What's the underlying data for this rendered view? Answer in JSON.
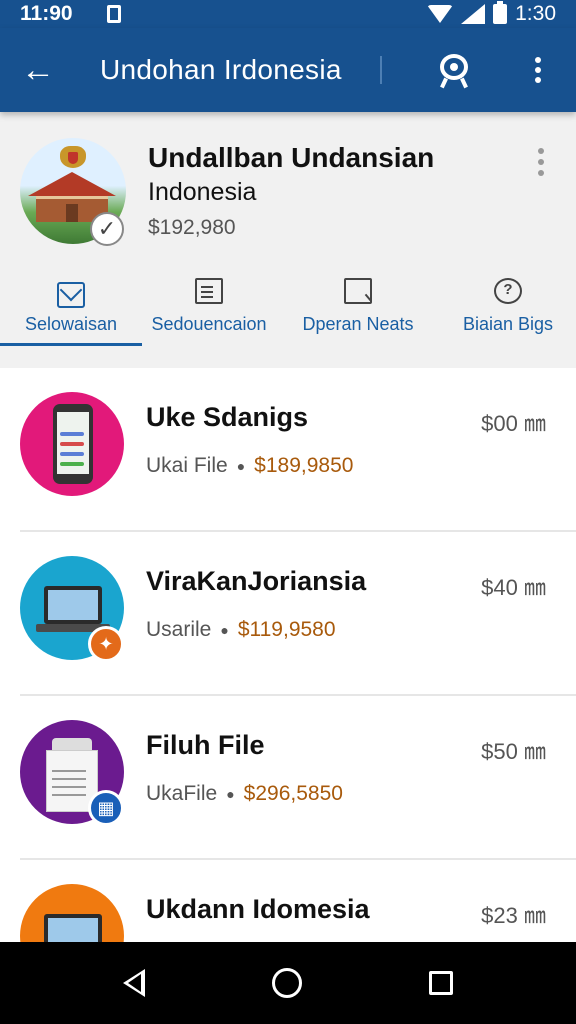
{
  "status_bar": {
    "time": "11:90",
    "right_time": "1:30"
  },
  "app_bar": {
    "back_glyph": "←",
    "title": "Undohan Irdonesia"
  },
  "profile": {
    "name": "Undallban Undansian",
    "subtitle": "Indonesia",
    "price": "$192,980",
    "verified_glyph": "✓"
  },
  "tabs": [
    {
      "label": "Selowaisan",
      "icon": "envelope-icon",
      "active": true
    },
    {
      "label": "Sedouencaion",
      "icon": "document-icon",
      "active": false
    },
    {
      "label": "Dperan Neats",
      "icon": "message-icon",
      "active": false
    },
    {
      "label": "Biaian Bigs",
      "icon": "help-icon",
      "active": false
    }
  ],
  "items": [
    {
      "title": "Uke Sdanigs",
      "meta_label": "Ukai File",
      "price": "$189,9850",
      "time": "$00 ㎜"
    },
    {
      "title": "ViraKanJoriansia",
      "meta_label": "Usarile",
      "price": "$119,9580",
      "time": "$40 ㎜"
    },
    {
      "title": "Filuh File",
      "meta_label": "UkaFile",
      "price": "$296,5850",
      "time": "$50 ㎜"
    },
    {
      "title": "Ukdann Idomesia",
      "meta_label": "",
      "price": "",
      "time": "$23 ㎜"
    }
  ],
  "colors": {
    "app_bar": "#17518f",
    "accent": "#1a5fa3",
    "price": "#a85a0c",
    "thumb_1": "#e2197a",
    "thumb_2": "#1aa5cf",
    "thumb_3": "#6b1b8f",
    "thumb_4": "#f07a10"
  }
}
